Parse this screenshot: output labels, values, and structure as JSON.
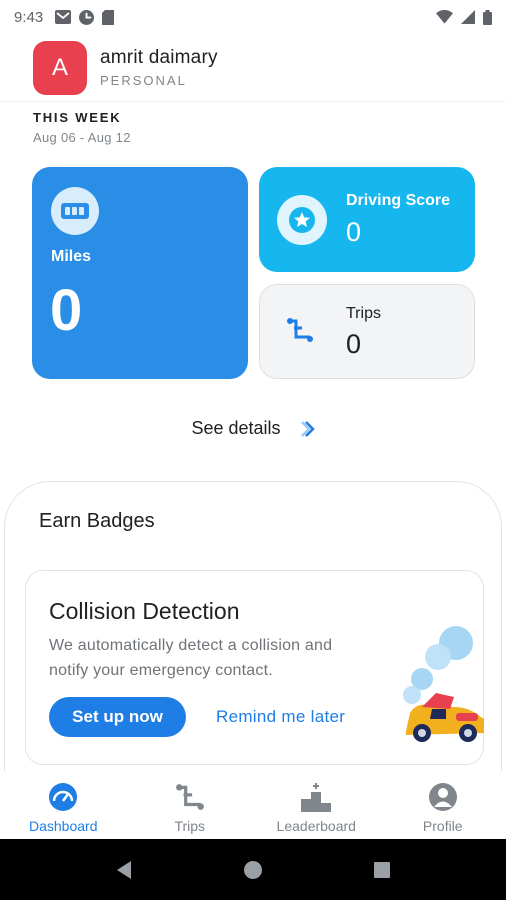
{
  "status_bar": {
    "time": "9:43"
  },
  "header": {
    "avatar_letter": "A",
    "user_name": "amrit daimary",
    "account_type": "PERSONAL"
  },
  "week": {
    "title": "THIS WEEK",
    "range": "Aug 06 - Aug 12"
  },
  "stats": {
    "miles": {
      "label": "Miles",
      "value": "0"
    },
    "driving_score": {
      "label": "Driving Score",
      "value": "0"
    },
    "trips": {
      "label": "Trips",
      "value": "0"
    }
  },
  "see_details": {
    "label": "See details"
  },
  "badges": {
    "title": "Earn Badges",
    "card": {
      "title": "Collision Detection",
      "description": "We automatically detect a collision and notify your emergency contact.",
      "primary_button": "Set up now",
      "secondary_link": "Remind me later"
    }
  },
  "bottom_nav": {
    "active": "Dashboard",
    "items": [
      {
        "label": "Dashboard",
        "icon": "speedometer-icon"
      },
      {
        "label": "Trips",
        "icon": "route-icon"
      },
      {
        "label": "Leaderboard",
        "icon": "podium-icon"
      },
      {
        "label": "Profile",
        "icon": "person-icon"
      }
    ]
  },
  "colors": {
    "accent": "#1f7ee5",
    "miles_card": "#2a8de6",
    "score_card": "#16b7ee",
    "avatar": "#e8404f"
  }
}
